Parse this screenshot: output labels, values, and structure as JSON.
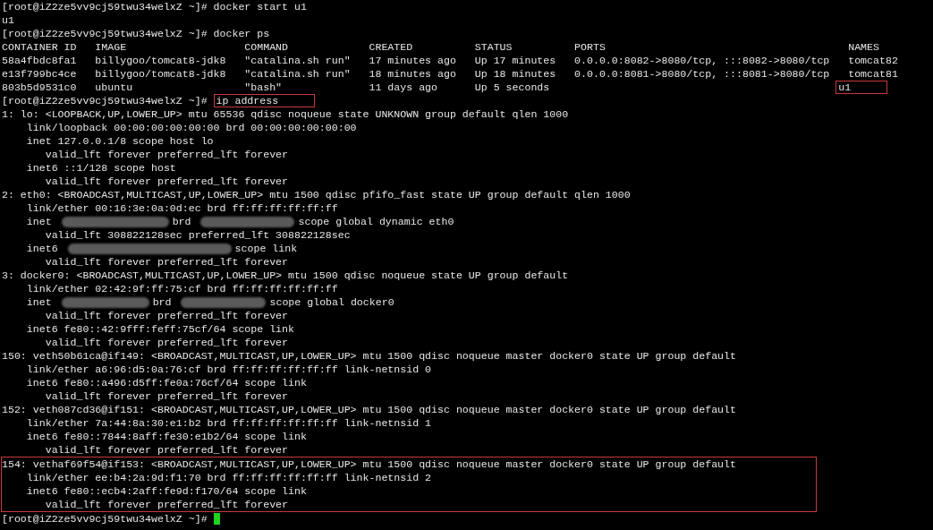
{
  "terminal": {
    "blocks": [
      {
        "highlighted": false,
        "lines": [
          {
            "kind": "plain",
            "text": "[root@iZ2ze5vv9cj59twu34welxZ ~]# docker start u1"
          },
          {
            "kind": "plain",
            "text": "u1"
          },
          {
            "kind": "plain",
            "text": "[root@iZ2ze5vv9cj59twu34welxZ ~]# docker ps"
          },
          {
            "kind": "plain",
            "text": "CONTAINER ID   IMAGE                   COMMAND             CREATED          STATUS          PORTS                                       NAMES"
          },
          {
            "kind": "plain",
            "text": "58a4fbdc8fa1   billygoo/tomcat8-jdk8   \"catalina.sh run\"   17 minutes ago   Up 17 minutes   0.0.0.0:8082->8080/tcp, :::8082->8080/tcp   tomcat82"
          },
          {
            "kind": "plain",
            "text": "e13f799bc4ce   billygoo/tomcat8-jdk8   \"catalina.sh run\"   18 minutes ago   Up 18 minutes   0.0.0.0:8081->8080/tcp, :::8081->8080/tcp   tomcat81"
          },
          {
            "kind": "boxed",
            "text": "803b5d9531c0   ubuntu                  \"bash\"              11 days ago      Up 5 seconds                                              ",
            "boxed": "u1"
          },
          {
            "kind": "boxed",
            "text": "[root@iZ2ze5vv9cj59twu34welxZ ~]# ",
            "boxed": "ip address"
          },
          {
            "kind": "plain",
            "text": "1: lo: <LOOPBACK,UP,LOWER_UP> mtu 65536 qdisc noqueue state UNKNOWN group default qlen 1000"
          },
          {
            "kind": "plain",
            "text": "    link/loopback 00:00:00:00:00:00 brd 00:00:00:00:00:00"
          },
          {
            "kind": "plain",
            "text": "    inet 127.0.0.1/8 scope host lo"
          },
          {
            "kind": "plain",
            "text": "       valid_lft forever preferred_lft forever"
          },
          {
            "kind": "plain",
            "text": "    inet6 ::1/128 scope host"
          },
          {
            "kind": "plain",
            "text": "       valid_lft forever preferred_lft forever"
          },
          {
            "kind": "plain",
            "text": "2: eth0: <BROADCAST,MULTICAST,UP,LOWER_UP> mtu 1500 qdisc pfifo_fast state UP group default qlen 1000"
          },
          {
            "kind": "plain",
            "text": "    link/ether 00:16:3e:0a:0d:ec brd ff:ff:ff:ff:ff:ff"
          },
          {
            "kind": "redacted",
            "parts": [
              "    inet ",
              "brd ",
              "scope global dynamic eth0"
            ]
          },
          {
            "kind": "plain",
            "text": "       valid_lft 308822128sec preferred_lft 308822128sec"
          },
          {
            "kind": "redacted",
            "parts": [
              "    inet6 ",
              "scope link"
            ]
          },
          {
            "kind": "plain",
            "text": "       valid_lft forever preferred_lft forever"
          },
          {
            "kind": "plain",
            "text": "3: docker0: <BROADCAST,MULTICAST,UP,LOWER_UP> mtu 1500 qdisc noqueue state UP group default"
          },
          {
            "kind": "plain",
            "text": "    link/ether 02:42:9f:ff:75:cf brd ff:ff:ff:ff:ff:ff"
          },
          {
            "kind": "redacted",
            "parts": [
              "    inet ",
              "brd ",
              "scope global docker0"
            ]
          },
          {
            "kind": "plain",
            "text": "       valid_lft forever preferred_lft forever"
          },
          {
            "kind": "plain",
            "text": "    inet6 fe80::42:9fff:feff:75cf/64 scope link"
          },
          {
            "kind": "plain",
            "text": "       valid_lft forever preferred_lft forever"
          },
          {
            "kind": "plain",
            "text": "150: veth50b61ca@if149: <BROADCAST,MULTICAST,UP,LOWER_UP> mtu 1500 qdisc noqueue master docker0 state UP group default"
          },
          {
            "kind": "plain",
            "text": "    link/ether a6:96:d5:0a:76:cf brd ff:ff:ff:ff:ff:ff link-netnsid 0"
          },
          {
            "kind": "plain",
            "text": "    inet6 fe80::a496:d5ff:fe0a:76cf/64 scope link"
          },
          {
            "kind": "plain",
            "text": "       valid_lft forever preferred_lft forever"
          },
          {
            "kind": "plain",
            "text": "152: veth087cd36@if151: <BROADCAST,MULTICAST,UP,LOWER_UP> mtu 1500 qdisc noqueue master docker0 state UP group default"
          },
          {
            "kind": "plain",
            "text": "    link/ether 7a:44:8a:30:e1:b2 brd ff:ff:ff:ff:ff:ff link-netnsid 1"
          },
          {
            "kind": "plain",
            "text": "    inet6 fe80::7844:8aff:fe30:e1b2/64 scope link"
          },
          {
            "kind": "plain",
            "text": "       valid_lft forever preferred_lft forever"
          }
        ]
      },
      {
        "highlighted": true,
        "lines": [
          {
            "kind": "plain",
            "text": "154: vethaf69f54@if153: <BROADCAST,MULTICAST,UP,LOWER_UP> mtu 1500 qdisc noqueue master docker0 state UP group default"
          },
          {
            "kind": "plain",
            "text": "    link/ether ee:b4:2a:9d:f1:70 brd ff:ff:ff:ff:ff:ff link-netnsid 2"
          },
          {
            "kind": "plain",
            "text": "    inet6 fe80::ecb4:2aff:fe9d:f170/64 scope link"
          },
          {
            "kind": "plain",
            "text": "       valid_lft forever preferred_lft forever"
          }
        ]
      },
      {
        "highlighted": false,
        "lines": [
          {
            "kind": "prompt",
            "text": "[root@iZ2ze5vv9cj59twu34welxZ ~]# ",
            "cursor": true
          }
        ]
      }
    ]
  }
}
